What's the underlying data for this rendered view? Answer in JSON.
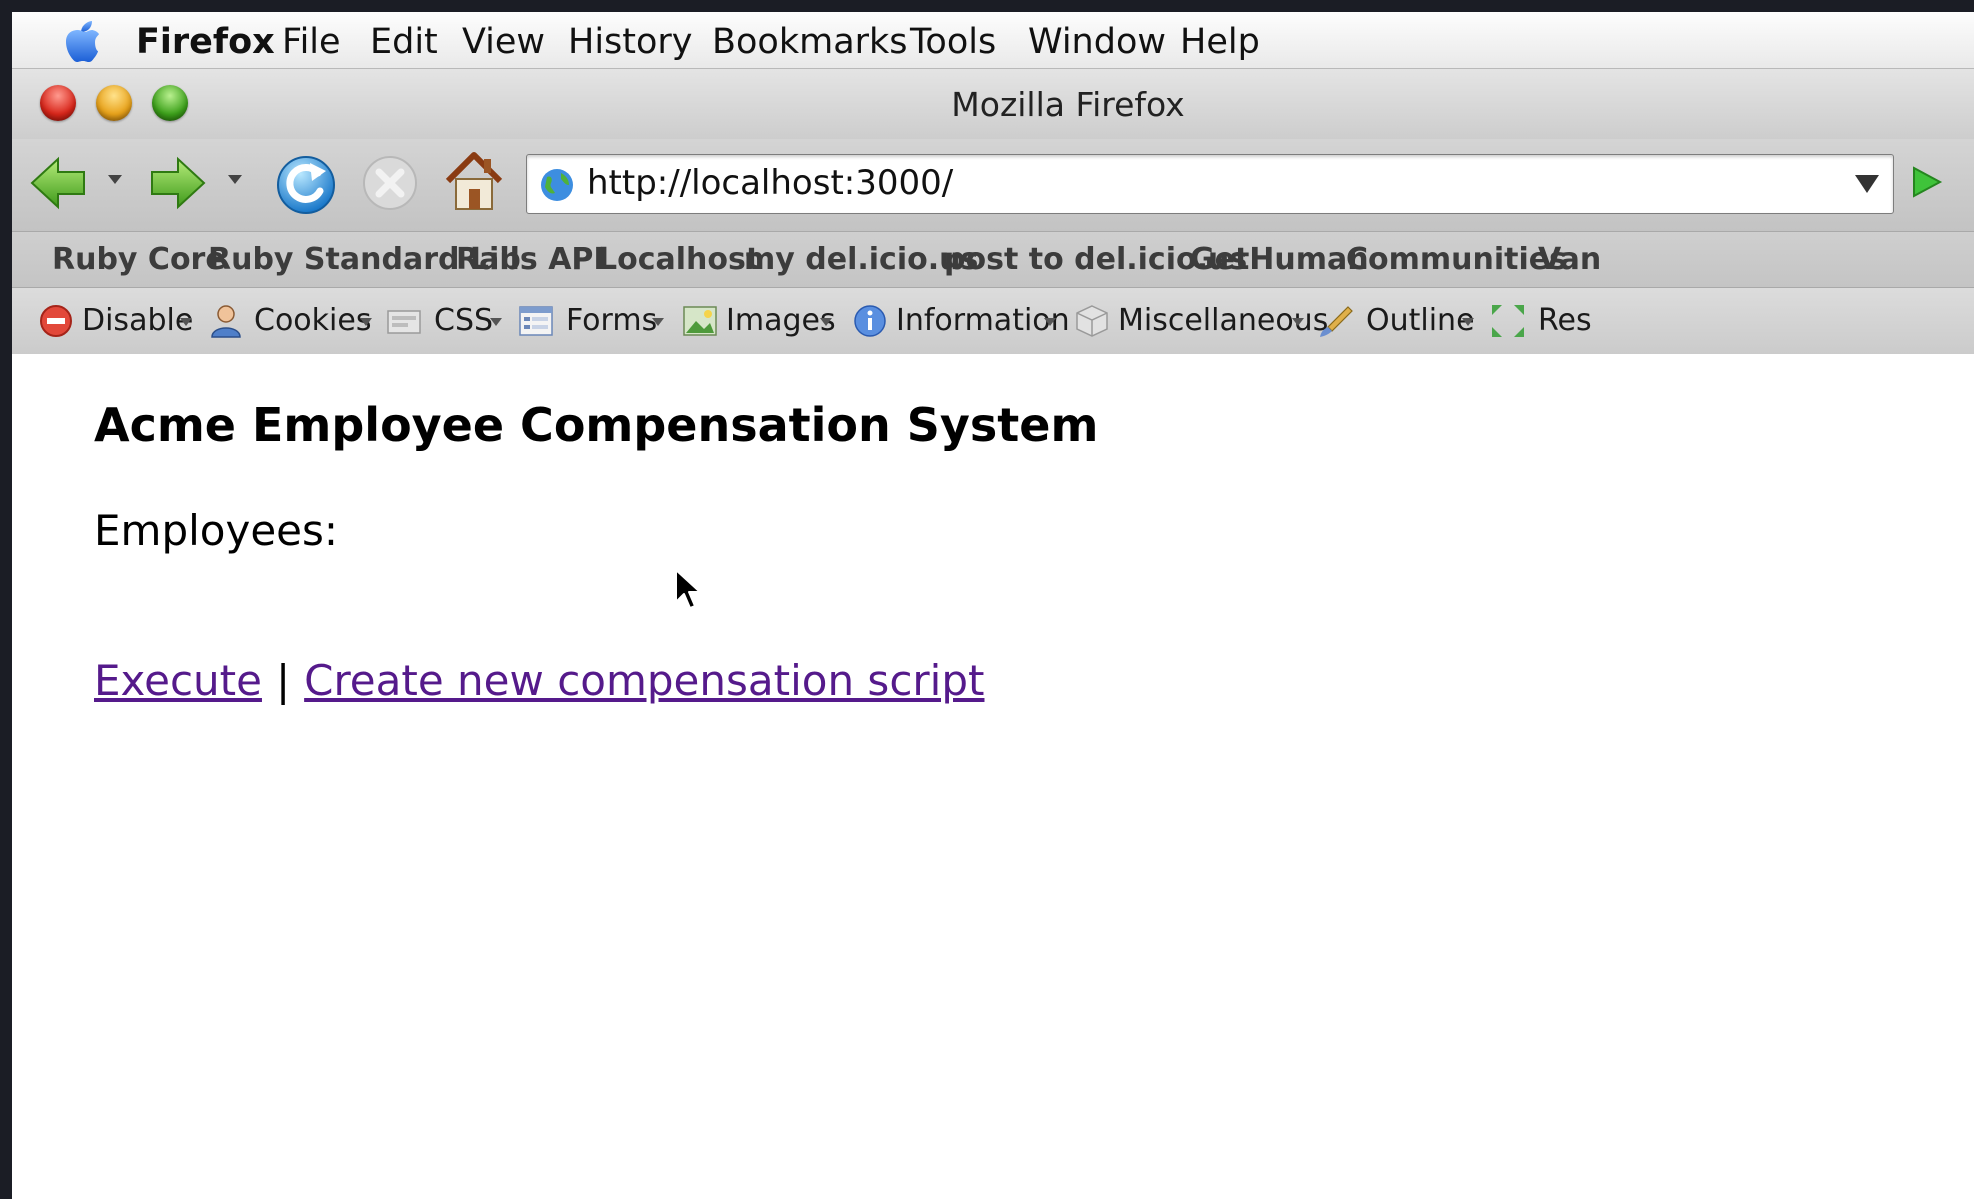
{
  "menubar": {
    "app_name": "Firefox",
    "items": [
      "File",
      "Edit",
      "View",
      "History",
      "Bookmarks",
      "Tools",
      "Window",
      "Help"
    ]
  },
  "window": {
    "title": "Mozilla Firefox"
  },
  "navbar": {
    "url": "http://localhost:3000/"
  },
  "bookmarks": [
    "Ruby Core",
    "Ruby Standard Lib",
    "Rails API",
    "Localhost",
    "my del.icio.us",
    "post to del.icio.us",
    "GetHuman",
    "Communities",
    "Van"
  ],
  "webdev_toolbar": [
    "Disable",
    "Cookies",
    "CSS",
    "Forms",
    "Images",
    "Information",
    "Miscellaneous",
    "Outline",
    "Res"
  ],
  "page": {
    "title": "Acme Employee Compensation System",
    "employees_label": "Employees:",
    "links": {
      "execute": "Execute",
      "separator": "|",
      "create": "Create new compensation script"
    }
  },
  "colors": {
    "visited_link": "#551a8b",
    "go_arrow": "#36b32b"
  }
}
